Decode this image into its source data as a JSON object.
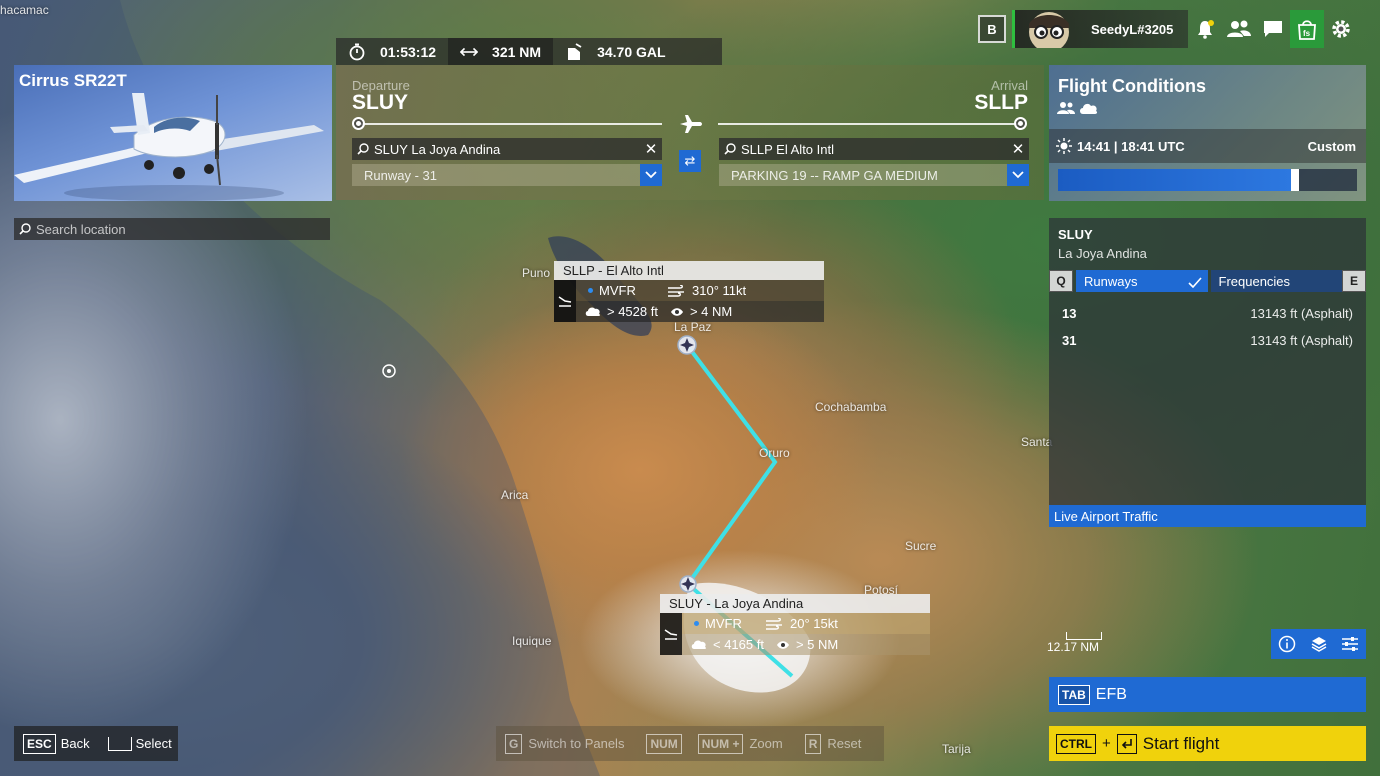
{
  "top_stats": {
    "flight_time": "01:53:12",
    "distance": "321 NM",
    "fuel": "34.70 GAL"
  },
  "aircraft": {
    "name": "Cirrus SR22T"
  },
  "flight_plan": {
    "departure_label": "Departure",
    "departure_code": "SLUY",
    "departure_search": "SLUY La Joya Andina",
    "departure_spawn": "Runway - 31",
    "arrival_label": "Arrival",
    "arrival_code": "SLLP",
    "arrival_search": "SLLP El Alto Intl",
    "arrival_spawn": "PARKING 19 -- RAMP GA MEDIUM"
  },
  "location_search": {
    "placeholder": "Search location"
  },
  "user": {
    "key": "B",
    "name": "SeedyL#3205"
  },
  "flight_conditions": {
    "title": "Flight Conditions",
    "time": "14:41 | 18:41 UTC",
    "mode": "Custom",
    "time_slider_fraction": 0.78
  },
  "airport_panel": {
    "code": "SLUY",
    "name": "La Joya Andina",
    "tab_prev_key": "Q",
    "tab_next_key": "E",
    "tabs": [
      "Runways",
      "Frequencies"
    ],
    "runways": [
      {
        "id": "13",
        "length": "13143 ft (Asphalt)"
      },
      {
        "id": "31",
        "length": "13143 ft (Asphalt)"
      }
    ],
    "live_traffic": "Live Airport Traffic"
  },
  "tooltips": {
    "arrival": {
      "title": "SLLP - El Alto Intl",
      "category": "MVFR",
      "wind": "310° 11kt",
      "ceiling": "> 4528 ft",
      "visibility": "> 4 NM"
    },
    "departure": {
      "title": "SLUY - La Joya Andina",
      "category": "MVFR",
      "wind": "20° 15kt",
      "ceiling": "< 4165 ft",
      "visibility": "> 5 NM"
    }
  },
  "map_labels": {
    "top_left": "hacamac",
    "puno": "Puno",
    "la_paz": "La Paz",
    "cochabamba": "Cochabamba",
    "oruro": "Oruro",
    "santa": "Santa",
    "arica": "Arica",
    "sucre": "Sucre",
    "potosi": "Potosí",
    "iquique": "Iquique",
    "tarija": "Tarija",
    "scale": "12.17 NM"
  },
  "efb": {
    "key": "TAB",
    "label": "EFB"
  },
  "start_flight": {
    "key": "CTRL",
    "plus": "+",
    "label": "Start flight"
  },
  "bottom_left": {
    "back_key": "ESC",
    "back_label": "Back",
    "select_label": "Select"
  },
  "bottom_mid": {
    "switch_key": "G",
    "switch_label": "Switch to Panels",
    "num_key": "NUM",
    "zoom_key": "NUM +",
    "zoom_label": "Zoom",
    "reset_key": "R",
    "reset_label": "Reset"
  },
  "colors": {
    "accent": "#1f6ad3",
    "start": "#f0d20c",
    "route": "#3fe0e6",
    "online": "#2fbf3f"
  }
}
